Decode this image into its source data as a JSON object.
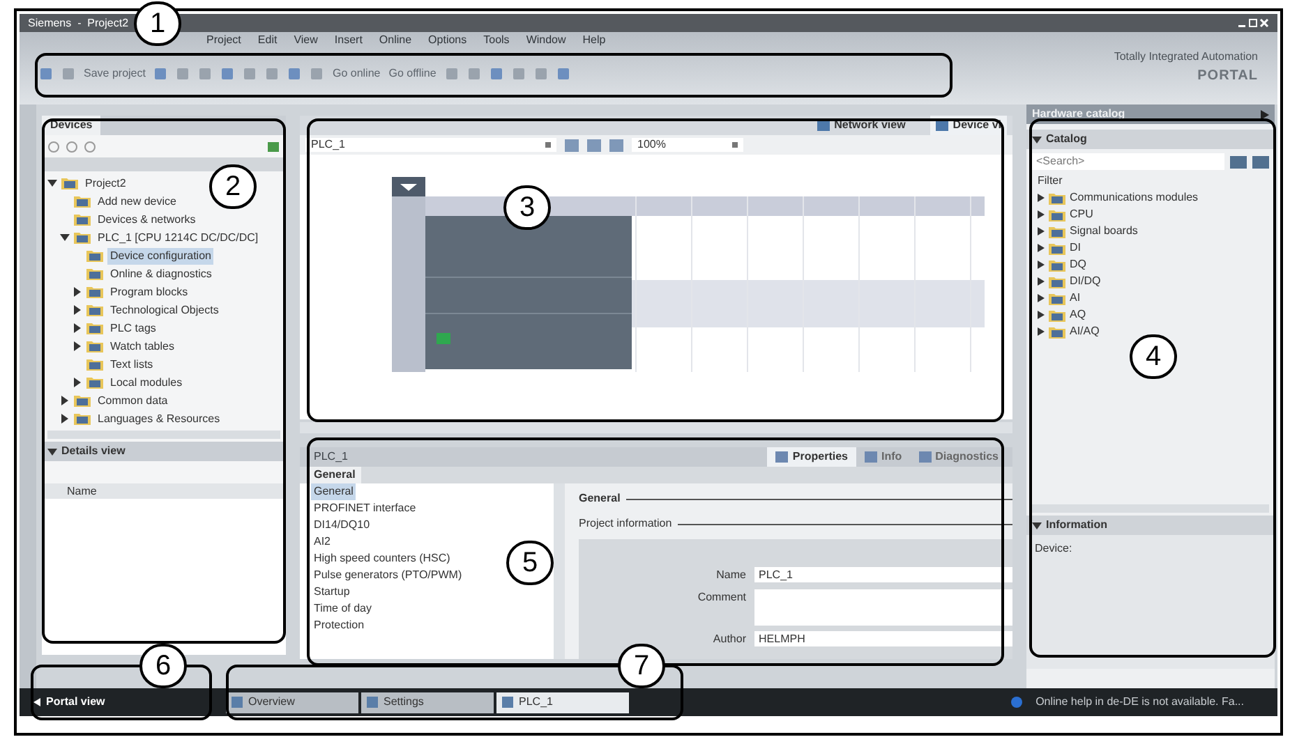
{
  "window": {
    "title": "Siemens  -  Project2"
  },
  "menu": [
    "Project",
    "Edit",
    "View",
    "Insert",
    "Online",
    "Options",
    "Tools",
    "Window",
    "Help"
  ],
  "toolbar": [
    {
      "kind": "icon"
    },
    {
      "kind": "icon"
    },
    {
      "kind": "label",
      "text": "Save project"
    },
    {
      "kind": "icon"
    },
    {
      "kind": "icon"
    },
    {
      "kind": "icon"
    },
    {
      "kind": "icon"
    },
    {
      "kind": "icon"
    },
    {
      "kind": "icon"
    },
    {
      "kind": "icon"
    },
    {
      "kind": "icon"
    },
    {
      "kind": "label",
      "text": "Go online"
    },
    {
      "kind": "label",
      "text": "Go offline"
    },
    {
      "kind": "icon"
    },
    {
      "kind": "icon"
    },
    {
      "kind": "icon"
    },
    {
      "kind": "icon"
    },
    {
      "kind": "icon"
    },
    {
      "kind": "icon"
    }
  ],
  "brand": {
    "line1": "Totally Integrated Automation",
    "line2": "PORTAL"
  },
  "project_tree": {
    "tab": "Devices",
    "items": [
      {
        "label": "Project2",
        "expanded": true,
        "selected": false,
        "children": [
          {
            "label": "Add new device",
            "selected": false
          },
          {
            "label": "Devices & networks",
            "selected": false
          },
          {
            "label": "PLC_1 [CPU 1214C DC/DC/DC]",
            "expanded": true,
            "selected": false,
            "children": [
              {
                "label": "Device configuration",
                "selected": true
              },
              {
                "label": "Online & diagnostics",
                "selected": false
              },
              {
                "label": "Program blocks",
                "expanded": false,
                "selected": false
              },
              {
                "label": "Technological Objects",
                "expanded": false,
                "selected": false
              },
              {
                "label": "PLC tags",
                "expanded": false,
                "selected": false
              },
              {
                "label": "Watch tables",
                "expanded": false,
                "selected": false
              },
              {
                "label": "Text lists",
                "selected": false
              },
              {
                "label": "Local modules",
                "expanded": false,
                "selected": false
              }
            ]
          },
          {
            "label": "Common data",
            "expanded": false,
            "selected": false
          },
          {
            "label": "Languages & Resources",
            "expanded": false,
            "selected": false
          }
        ]
      }
    ]
  },
  "details_view": {
    "title": "Details view",
    "column": "Name"
  },
  "editor": {
    "tabs": [
      {
        "label": "Network view",
        "selected": false
      },
      {
        "label": "Device vi",
        "selected": true
      }
    ],
    "device": "PLC_1",
    "zoom": "100%"
  },
  "inspector": {
    "title": "PLC_1",
    "tabs": [
      {
        "label": "Properties",
        "selected": true
      },
      {
        "label": "Info",
        "selected": false
      },
      {
        "label": "Diagnostics",
        "selected": false
      }
    ],
    "subtab": "General",
    "nav": [
      {
        "label": "General",
        "selected": true
      },
      {
        "label": "PROFINET interface",
        "selected": false
      },
      {
        "label": "DI14/DQ10",
        "selected": false
      },
      {
        "label": "AI2",
        "selected": false
      },
      {
        "label": "High speed counters (HSC)",
        "selected": false
      },
      {
        "label": "Pulse generators (PTO/PWM)",
        "selected": false
      },
      {
        "label": "Startup",
        "selected": false
      },
      {
        "label": "Time of day",
        "selected": false
      },
      {
        "label": "Protection",
        "selected": false
      }
    ],
    "section": "General",
    "subsection": "Project information",
    "fields": [
      {
        "label": "Name",
        "value": "PLC_1",
        "kind": "line"
      },
      {
        "label": "Comment",
        "kind": "area"
      },
      {
        "label": "Author",
        "value": "HELMPH",
        "kind": "line"
      }
    ]
  },
  "catalog": {
    "title": "Hardware catalog",
    "section": "Catalog",
    "search_placeholder": "<Search>",
    "filter": "Filter",
    "items": [
      "Communications modules",
      "CPU",
      "Signal boards",
      "DI",
      "DQ",
      "DI/DQ",
      "AI",
      "AQ",
      "AI/AQ"
    ],
    "info_title": "Information",
    "info_label": "Device:"
  },
  "portal_view": "Portal view",
  "editor_tabs": [
    {
      "label": "Overview",
      "selected": false
    },
    {
      "label": "Settings",
      "selected": false
    },
    {
      "label": "PLC_1",
      "selected": true
    }
  ],
  "status": "Online help in de-DE is not available. Fa...",
  "callouts": [
    "1",
    "2",
    "3",
    "4",
    "5",
    "6",
    "7"
  ]
}
